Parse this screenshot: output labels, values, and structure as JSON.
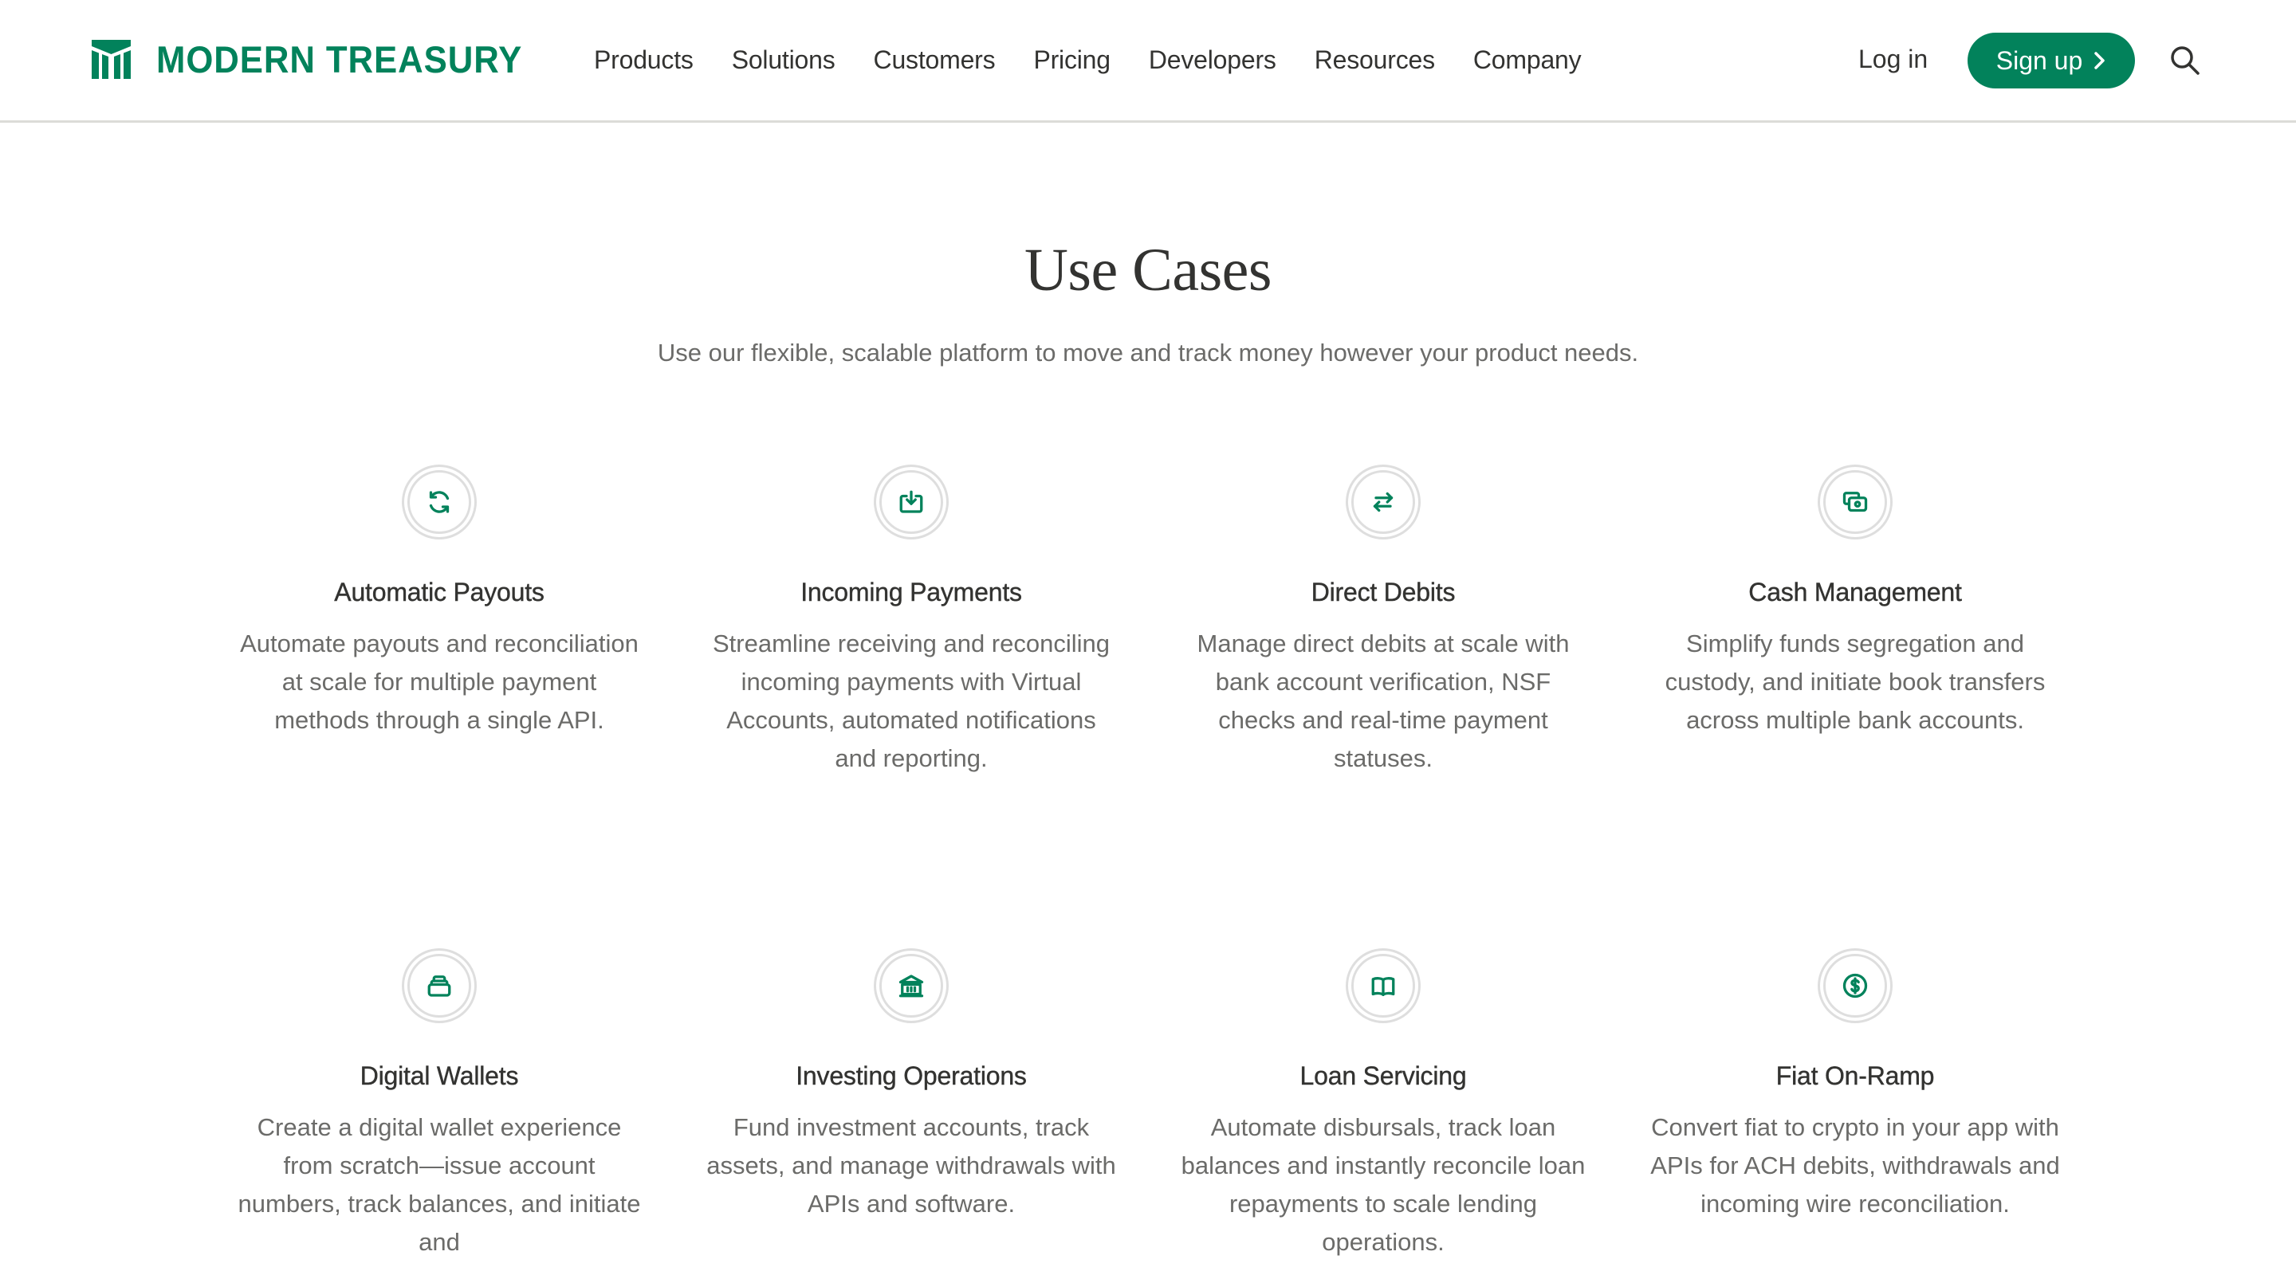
{
  "brand": {
    "name": "MODERN TREASURY",
    "color": "#02825b"
  },
  "nav": {
    "items": [
      "Products",
      "Solutions",
      "Customers",
      "Pricing",
      "Developers",
      "Resources",
      "Company"
    ],
    "login_label": "Log in",
    "signup_label": "Sign up",
    "search_icon": "search-icon"
  },
  "hero": {
    "title": "Use Cases",
    "subtitle": "Use our flexible, scalable platform to move and track money however your product needs."
  },
  "use_cases": [
    {
      "icon": "refresh-icon",
      "title": "Automatic Payouts",
      "description": "Automate payouts and reconciliation at scale for multiple payment methods through a single API."
    },
    {
      "icon": "inbox-download-icon",
      "title": "Incoming Payments",
      "description": "Streamline receiving and reconciling incoming payments with Virtual Accounts, automated notifications and reporting."
    },
    {
      "icon": "arrows-exchange-icon",
      "title": "Direct Debits",
      "description": "Manage direct debits at scale with bank account verification, NSF checks and real-time payment statuses."
    },
    {
      "icon": "cash-stack-icon",
      "title": "Cash Management",
      "description": "Simplify funds segregation and custody, and initiate book transfers across multiple bank accounts."
    },
    {
      "icon": "wallet-stack-icon",
      "title": "Digital Wallets",
      "description": "Create a digital wallet experience from scratch—issue account numbers, track balances, and initiate and"
    },
    {
      "icon": "bank-building-icon",
      "title": "Investing Operations",
      "description": "Fund investment accounts, track assets, and manage withdrawals with APIs and software."
    },
    {
      "icon": "open-book-icon",
      "title": "Loan Servicing",
      "description": "Automate disbursals, track loan balances and instantly reconcile loan repayments to scale lending operations."
    },
    {
      "icon": "dollar-coin-icon",
      "title": "Fiat On-Ramp",
      "description": "Convert fiat to crypto in your app with APIs for ACH debits, withdrawals and incoming wire reconciliation."
    }
  ]
}
